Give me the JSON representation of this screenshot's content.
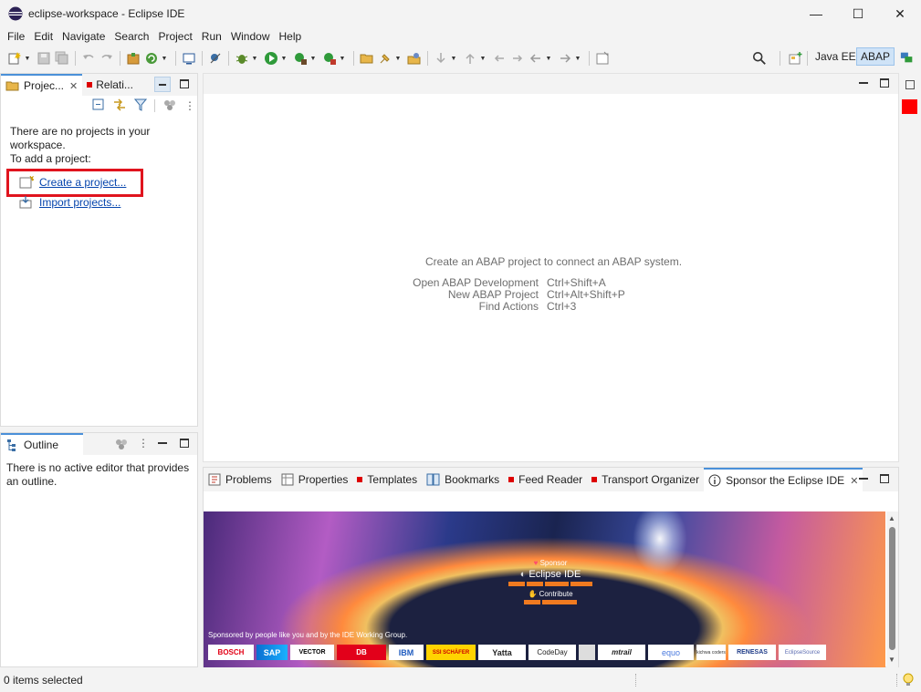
{
  "window": {
    "title": "eclipse-workspace - Eclipse IDE",
    "controls": {
      "minimize": "—",
      "maximize": "☐",
      "close": "✕"
    }
  },
  "menu": [
    "File",
    "Edit",
    "Navigate",
    "Search",
    "Project",
    "Run",
    "Window",
    "Help"
  ],
  "perspectives": {
    "java_ee": "Java EE",
    "abap": "ABAP"
  },
  "project_explorer": {
    "tab_label": "Projec...",
    "relations_tab_label": "Relati...",
    "empty_line1": "There are no projects in your",
    "empty_line2": "workspace.",
    "empty_line3": "To add a project:",
    "create_link": "Create a project...",
    "import_link": "Import projects..."
  },
  "outline": {
    "tab_label": "Outline",
    "message_line1": "There is no active editor that provides",
    "message_line2": "an outline."
  },
  "editor": {
    "hint": "Create an ABAP project to connect an ABAP system.",
    "shortcuts": [
      {
        "label": "Open ABAP Development",
        "keys": "Ctrl+Shift+A"
      },
      {
        "label": "New ABAP Project",
        "keys": "Ctrl+Alt+Shift+P"
      },
      {
        "label": "Find Actions",
        "keys": "Ctrl+3"
      }
    ]
  },
  "bottom_tabs": [
    "Problems",
    "Properties",
    "Templates",
    "Bookmarks",
    "Feed Reader",
    "Transport Organizer",
    "Sponsor the Eclipse IDE"
  ],
  "sponsor": {
    "sponsor_label": "Sponsor",
    "eclipse_ide": "Eclipse IDE",
    "contribute": "Contribute",
    "sponsored_by": "Sponsored by people like you and by the IDE Working Group.",
    "logos": [
      "BOSCH",
      "SAP",
      "VECTOR",
      "DB",
      "IBM",
      "SSI SCHÄFER",
      "Yatta",
      "CodeDay",
      "",
      "mtrail",
      "equo",
      "kichwa coders",
      "RENESAS",
      "EclipseSource"
    ]
  },
  "status": {
    "text": "0 items selected"
  },
  "colors": {
    "accent": "#4a90d9",
    "highlight_box": "#e0141e",
    "link": "#0645ad",
    "red_marker": "#ff0000"
  }
}
